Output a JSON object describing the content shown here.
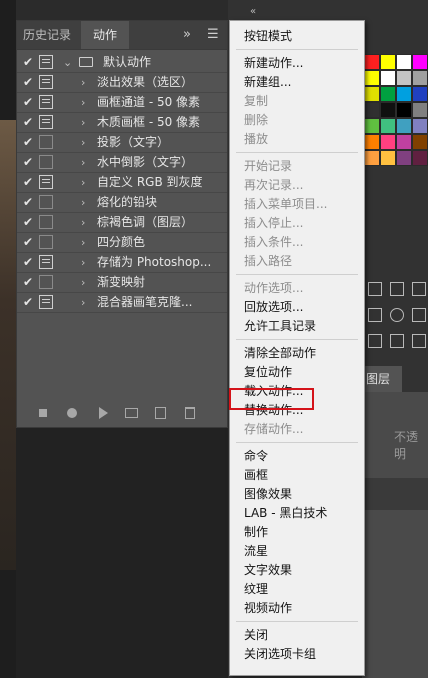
{
  "panel": {
    "tabs": {
      "history": "历史记录",
      "actions": "动作",
      "more": "»",
      "menu": "☰"
    },
    "group": {
      "name": "默认动作",
      "checked": true,
      "dialog": true
    },
    "actions": [
      {
        "name": "淡出效果（选区）",
        "checked": true,
        "dialog": true
      },
      {
        "name": "画框通道 - 50 像素",
        "checked": true,
        "dialog": true
      },
      {
        "name": "木质画框 - 50 像素",
        "checked": true,
        "dialog": true
      },
      {
        "name": "投影（文字）",
        "checked": true,
        "dialog": false
      },
      {
        "name": "水中倒影（文字）",
        "checked": true,
        "dialog": false
      },
      {
        "name": "自定义 RGB 到灰度",
        "checked": true,
        "dialog": true
      },
      {
        "name": "熔化的铅块",
        "checked": true,
        "dialog": false
      },
      {
        "name": "棕褐色调（图层）",
        "checked": true,
        "dialog": false
      },
      {
        "name": "四分颜色",
        "checked": true,
        "dialog": false
      },
      {
        "name": "存储为 Photoshop...",
        "checked": true,
        "dialog": true
      },
      {
        "name": "渐变映射",
        "checked": true,
        "dialog": false
      },
      {
        "name": "混合器画笔克隆...",
        "checked": true,
        "dialog": true
      }
    ]
  },
  "menu": {
    "items": [
      {
        "label": "按钮模式",
        "enabled": true
      },
      {
        "sep": true
      },
      {
        "label": "新建动作...",
        "enabled": true
      },
      {
        "label": "新建组...",
        "enabled": true
      },
      {
        "label": "复制",
        "enabled": false
      },
      {
        "label": "删除",
        "enabled": false
      },
      {
        "label": "播放",
        "enabled": false
      },
      {
        "sep": true
      },
      {
        "label": "开始记录",
        "enabled": false
      },
      {
        "label": "再次记录...",
        "enabled": false
      },
      {
        "label": "插入菜单项目...",
        "enabled": false
      },
      {
        "label": "插入停止...",
        "enabled": false
      },
      {
        "label": "插入条件...",
        "enabled": false
      },
      {
        "label": "插入路径",
        "enabled": false
      },
      {
        "sep": true
      },
      {
        "label": "动作选项...",
        "enabled": false
      },
      {
        "label": "回放选项...",
        "enabled": true
      },
      {
        "label": "允许工具记录",
        "enabled": true
      },
      {
        "sep": true
      },
      {
        "label": "清除全部动作",
        "enabled": true
      },
      {
        "label": "复位动作",
        "enabled": true
      },
      {
        "label": "载入动作...",
        "enabled": true,
        "highlighted": true
      },
      {
        "label": "替换动作...",
        "enabled": true
      },
      {
        "label": "存储动作...",
        "enabled": false
      },
      {
        "sep": true
      },
      {
        "label": "命令",
        "enabled": true
      },
      {
        "label": "画框",
        "enabled": true
      },
      {
        "label": "图像效果",
        "enabled": true
      },
      {
        "label": "LAB - 黑白技术",
        "enabled": true
      },
      {
        "label": "制作",
        "enabled": true
      },
      {
        "label": "流星",
        "enabled": true
      },
      {
        "label": "文字效果",
        "enabled": true
      },
      {
        "label": "纹理",
        "enabled": true
      },
      {
        "label": "视频动作",
        "enabled": true
      },
      {
        "sep": true
      },
      {
        "label": "关闭",
        "enabled": true
      },
      {
        "label": "关闭选项卡组",
        "enabled": true
      }
    ]
  },
  "right": {
    "layers_tab": "图层",
    "opacity_label": "不透明",
    "collapse": "«"
  },
  "colors": {
    "swatches": [
      "#ff2020",
      "#ffff00",
      "#ffffff",
      "#ff00ff",
      "#ffff00",
      "#ffffff",
      "#c4c4c4",
      "#a0a0a0",
      "#e0e000",
      "#00a040",
      "#00a0e0",
      "#2040c0",
      "#303030",
      "#101010",
      "#000000",
      "#808080",
      "#60c040",
      "#40c080",
      "#40a0c0",
      "#8080c0",
      "#ff8000",
      "#ff4080",
      "#c040a0",
      "#804000",
      "#ffa040",
      "#ffc040",
      "#804080",
      "#602040"
    ],
    "highlight": "#d4131a"
  }
}
